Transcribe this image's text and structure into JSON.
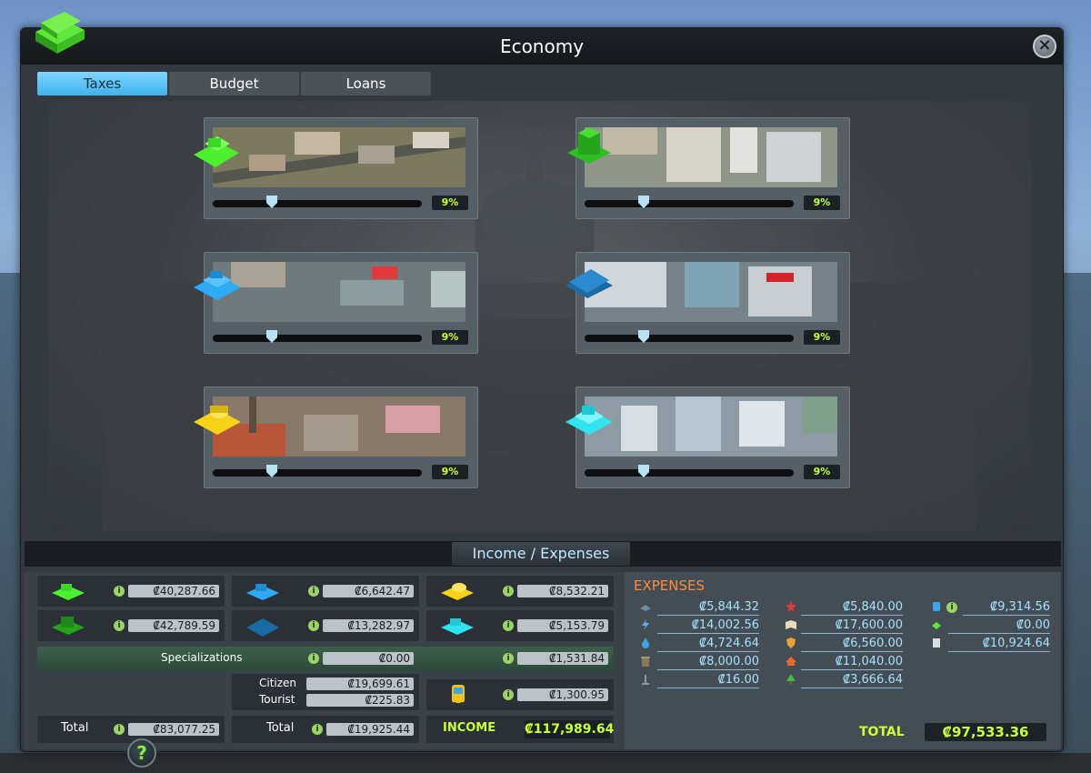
{
  "window": {
    "title": "Economy",
    "close_symbol": "×"
  },
  "tabs": [
    {
      "label": "Taxes",
      "active": true
    },
    {
      "label": "Budget",
      "active": false
    },
    {
      "label": "Loans",
      "active": false
    }
  ],
  "tax_cards": [
    {
      "zone": "residential-low",
      "rate": 9,
      "percent_label": "9%",
      "color": "#3ee82a"
    },
    {
      "zone": "residential-high",
      "rate": 9,
      "percent_label": "9%",
      "color": "#22b81b"
    },
    {
      "zone": "commercial-low",
      "rate": 9,
      "percent_label": "9%",
      "color": "#2aa9f2"
    },
    {
      "zone": "commercial-high",
      "rate": 9,
      "percent_label": "9%",
      "color": "#1f6fa8"
    },
    {
      "zone": "industrial",
      "rate": 9,
      "percent_label": "9%",
      "color": "#f2d21c"
    },
    {
      "zone": "office",
      "rate": 9,
      "percent_label": "9%",
      "color": "#2fe6ee"
    }
  ],
  "section_title": "Income / Expenses",
  "income": {
    "res_low": "₡40,287.66",
    "res_high": "₡42,789.59",
    "com_low": "₡6,642.47",
    "com_high": "₡13,282.97",
    "industrial": "₡8,532.21",
    "office": "₡5,153.79",
    "specializations_label": "Specializations",
    "specializations_value": "₡0.00",
    "specializations_value2": "₡1,531.84",
    "citizen_label": "Citizen",
    "citizen_value": "₡19,699.61",
    "tourist_label": "Tourist",
    "tourist_value": "₡225.83",
    "transport_value": "₡1,300.95",
    "total_label_1": "Total",
    "total_value_1": "₡83,077.25",
    "total_label_2": "Total",
    "total_value_2": "₡19,925.44",
    "income_label": "INCOME",
    "income_value": "₡117,989.64"
  },
  "expenses": {
    "title": "EXPENSES",
    "col1": [
      {
        "icon": "road-icon",
        "value": "₡5,844.32"
      },
      {
        "icon": "power-icon",
        "value": "₡14,002.56"
      },
      {
        "icon": "water-icon",
        "value": "₡4,724.64"
      },
      {
        "icon": "garbage-icon",
        "value": "₡8,000.00"
      },
      {
        "icon": "monument-icon",
        "value": "₡16.00"
      }
    ],
    "col2": [
      {
        "icon": "health-icon",
        "value": "₡5,840.00"
      },
      {
        "icon": "education-icon",
        "value": "₡17,600.00"
      },
      {
        "icon": "police-icon",
        "value": "₡6,560.00"
      },
      {
        "icon": "fire-icon",
        "value": "₡11,040.00"
      },
      {
        "icon": "park-icon",
        "value": "₡3,666.64"
      }
    ],
    "col3": [
      {
        "icon": "transport-icon",
        "value": "₡9,314.56"
      },
      {
        "icon": "policy-icon",
        "value": "₡0.00"
      },
      {
        "icon": "loan-icon",
        "value": "₡10,924.64"
      }
    ],
    "total_label": "TOTAL",
    "total_value": "₡97,533.36"
  },
  "help_symbol": "?"
}
